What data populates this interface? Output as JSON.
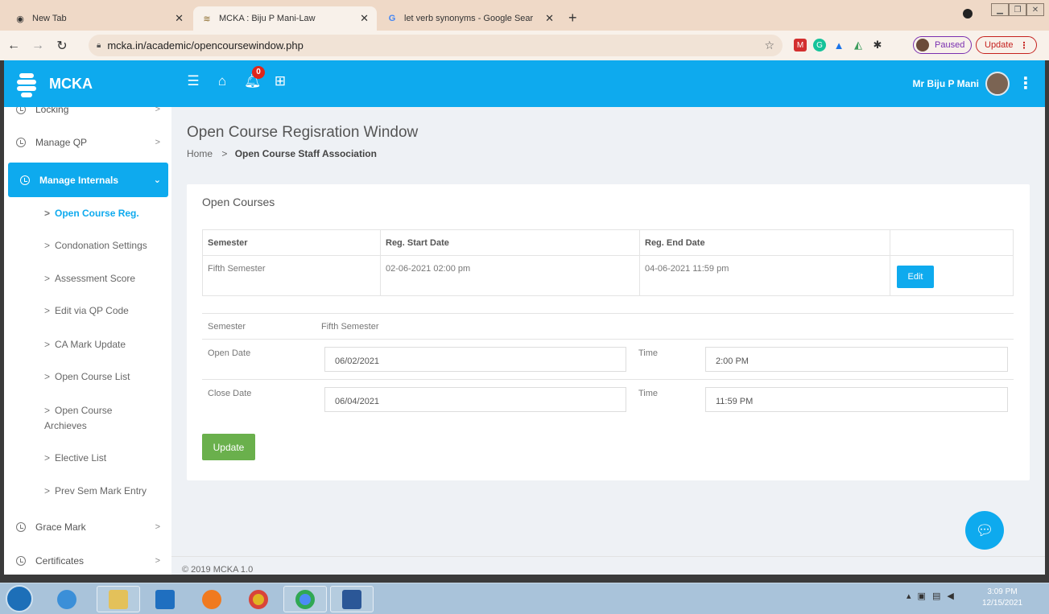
{
  "browser": {
    "tabs": [
      {
        "title": "New Tab",
        "icon": "chrome-icon"
      },
      {
        "title": "MCKA : Biju P Mani-Law",
        "icon": "mcka-favicon"
      },
      {
        "title": "let verb synonyms - Google Sear",
        "icon": "google-icon"
      }
    ],
    "new_tab_symbol": "+",
    "url": "mcka.in/academic/opencoursewindow.php",
    "profile_label": "Paused",
    "update_label": "Update"
  },
  "colors": {
    "primary": "#0eaaee",
    "success": "#6ab04c",
    "badge": "#e0261b"
  },
  "app": {
    "brand": "MCKA",
    "notification_count": "0",
    "user_name": "Mr Biju P Mani"
  },
  "sidebar": {
    "top_items": [
      {
        "label": "Locking"
      },
      {
        "label": "Manage QP"
      },
      {
        "label": "Manage Internals"
      }
    ],
    "sub_items": [
      {
        "label": "Open Course Reg."
      },
      {
        "label": "Condonation Settings"
      },
      {
        "label": "Assessment Score"
      },
      {
        "label": "Edit via QP Code"
      },
      {
        "label": "CA Mark Update"
      },
      {
        "label": "Open Course List"
      },
      {
        "label": "Open Course",
        "label2": "Archieves"
      },
      {
        "label": "Elective List"
      },
      {
        "label": "Prev Sem Mark Entry"
      }
    ],
    "bottom_items": [
      {
        "label": "Grace Mark"
      },
      {
        "label": "Certificates"
      }
    ]
  },
  "page": {
    "title": "Open Course Regisration Window",
    "breadcrumb_home": "Home",
    "breadcrumb_sep": ">",
    "breadcrumb_current": "Open Course Staff Association",
    "card_title": "Open Courses"
  },
  "table": {
    "headers": [
      "Semester",
      "Reg. Start Date",
      "Reg. End Date",
      ""
    ],
    "rows": [
      {
        "semester": "Fifth Semester",
        "start": "02-06-2021 02:00 pm",
        "end": "04-06-2021 11:59 pm",
        "action": "Edit"
      }
    ]
  },
  "form": {
    "semester_label": "Semester",
    "semester_value": "Fifth Semester",
    "open_date_label": "Open Date",
    "open_date_value": "06/02/2021",
    "open_time_label": "Time",
    "open_time_value": "2:00 PM",
    "close_date_label": "Close Date",
    "close_date_value": "06/04/2021",
    "close_time_label": "Time",
    "close_time_value": "11:59 PM",
    "submit_label": "Update"
  },
  "footer": "© 2019 MCKA 1.0",
  "taskbar": {
    "time": "3:09 PM",
    "date": "12/15/2021"
  }
}
